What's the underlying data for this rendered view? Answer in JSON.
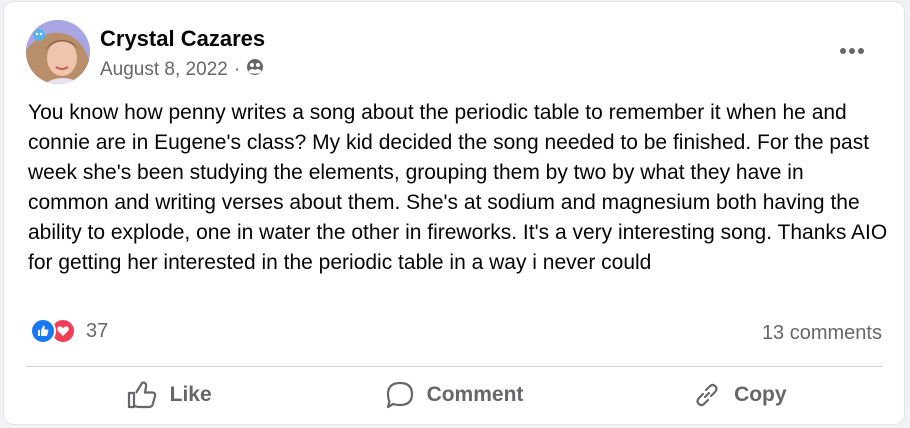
{
  "post": {
    "author": "Crystal Cazares",
    "date": "August 8, 2022",
    "separator": "·",
    "privacy_icon": "friends-icon",
    "text": "You know how penny writes a song about the periodic table to remember it when he and connie are in Eugene's class? My kid decided the song needed to be finished.  For the past week she's been studying the elements,  grouping them by two by what they have in common and writing verses about them.  She's at sodium and magnesium both having the ability to explode,  one in water the other in fireworks.  It's a very interesting song.  Thanks AIO for getting her interested in the periodic table in a way i never could"
  },
  "stats": {
    "reaction_count": "37",
    "comments": "13 comments"
  },
  "actions": {
    "like": "Like",
    "comment": "Comment",
    "copy": "Copy"
  },
  "colors": {
    "like_blue": "#1877f2",
    "love_red": "#f33e58",
    "muted_text": "#65676b"
  }
}
